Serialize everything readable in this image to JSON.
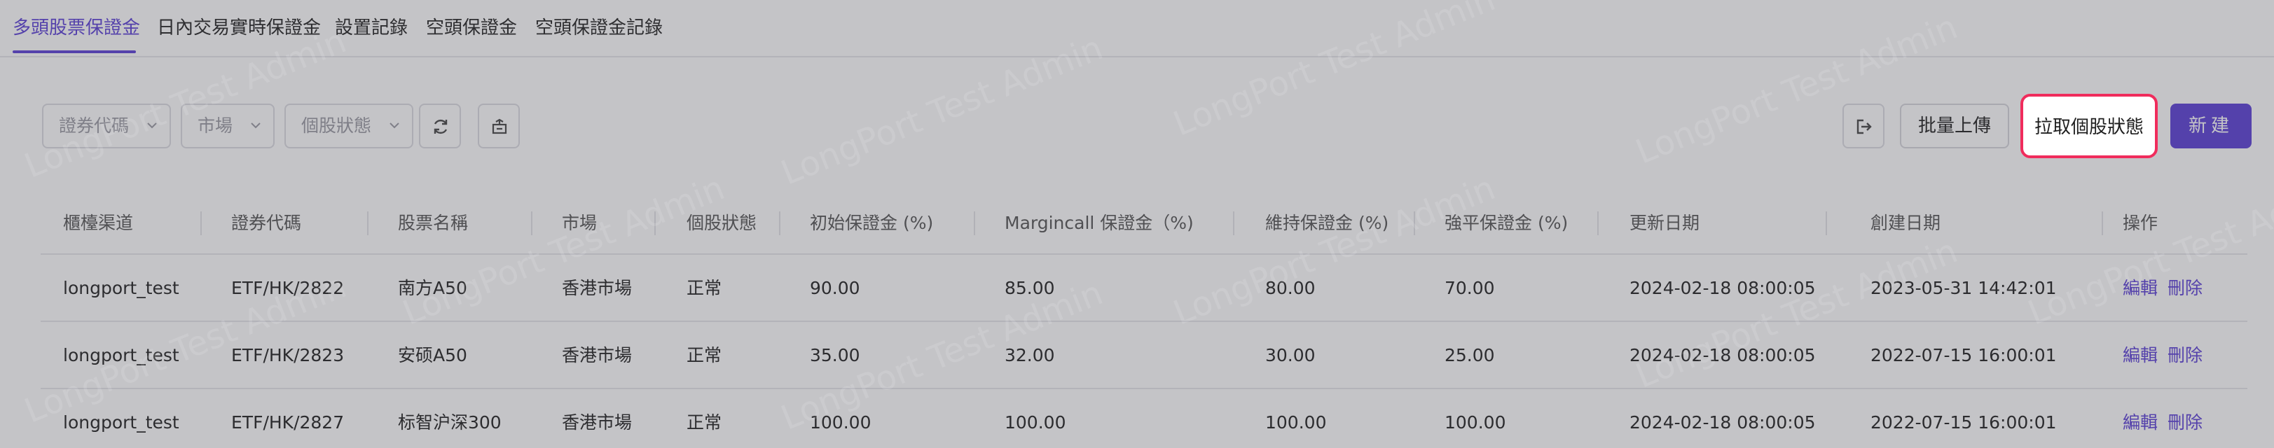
{
  "tabs": [
    {
      "label": "多頭股票保證金",
      "active": true
    },
    {
      "label": "日內交易實時保證金",
      "active": false
    },
    {
      "label": "設置記錄",
      "active": false
    },
    {
      "label": "空頭保證金",
      "active": false
    },
    {
      "label": "空頭保證金記錄",
      "active": false
    }
  ],
  "filters": {
    "security_code": {
      "placeholder": "證券代碼"
    },
    "market": {
      "placeholder": "市場"
    },
    "stock_status": {
      "placeholder": "個股狀態"
    }
  },
  "icons": {
    "refresh": "refresh-icon",
    "columns": "table-settings-icon",
    "export": "export-icon",
    "chevron": "chevron-down-icon"
  },
  "actions": {
    "batch_upload": "批量上傳",
    "fetch_status": "拉取個股狀態",
    "create": "新建"
  },
  "table": {
    "columns": [
      "櫃檯渠道",
      "證券代碼",
      "股票名稱",
      "市場",
      "個股狀態",
      "初始保證金 (%)",
      "Margincall 保證金（%)",
      "維持保證金 (%)",
      "強平保證金 (%)",
      "更新日期",
      "創建日期",
      "操作"
    ],
    "rows": [
      {
        "channel": "longport_test",
        "code": "ETF/HK/2822",
        "name": "南方A50",
        "market": "香港市場",
        "status": "正常",
        "initial": "90.00",
        "margincall": "85.00",
        "maintenance": "80.00",
        "liquidation": "70.00",
        "updated": "2024-02-18 08:00:05",
        "created": "2023-05-31 14:42:01",
        "edit": "編輯",
        "delete": "刪除"
      },
      {
        "channel": "longport_test",
        "code": "ETF/HK/2823",
        "name": "安硕A50",
        "market": "香港市場",
        "status": "正常",
        "initial": "35.00",
        "margincall": "32.00",
        "maintenance": "30.00",
        "liquidation": "25.00",
        "updated": "2024-02-18 08:00:05",
        "created": "2022-07-15 16:00:01",
        "edit": "編輯",
        "delete": "刪除"
      },
      {
        "channel": "longport_test",
        "code": "ETF/HK/2827",
        "name": "标智沪深300",
        "market": "香港市場",
        "status": "正常",
        "initial": "100.00",
        "margincall": "100.00",
        "maintenance": "100.00",
        "liquidation": "100.00",
        "updated": "2024-02-18 08:00:05",
        "created": "2022-07-15 16:00:01",
        "edit": "編輯",
        "delete": "刪除"
      }
    ]
  },
  "watermark": "LongPort Test Admin",
  "colors": {
    "accent": "#5b3fd6",
    "highlight": "#f02c5c"
  }
}
